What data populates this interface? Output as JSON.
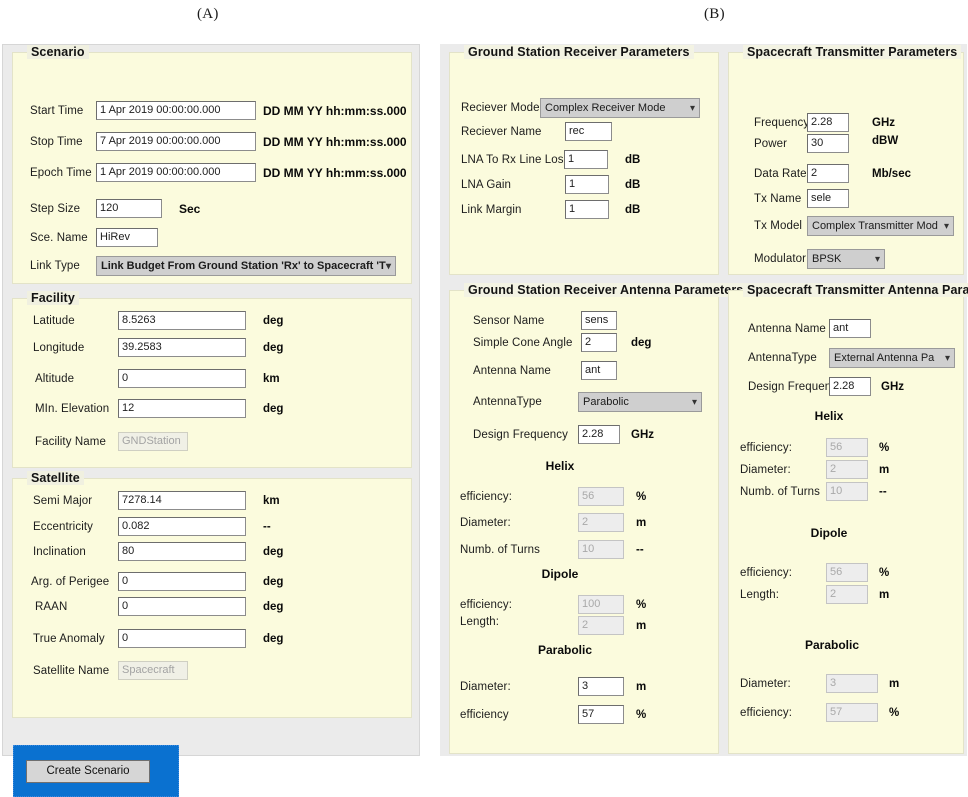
{
  "figure": {
    "label_a": "(A)",
    "label_b": "(B)"
  },
  "panel_a": {
    "scenario": {
      "title": "Scenario",
      "rows": [
        {
          "label": "Start Time",
          "value": "1 Apr 2019 00:00:00.000",
          "unit": "DD MM YY hh:mm:ss.000"
        },
        {
          "label": "Stop Time",
          "value": "7 Apr 2019 00:00:00.000",
          "unit": "DD MM YY hh:mm:ss.000"
        },
        {
          "label": "Epoch Time",
          "value": "1 Apr 2019 00:00:00.000",
          "unit": "DD MM YY hh:mm:ss.000"
        },
        {
          "label": "Step Size",
          "value": "120",
          "unit": "Sec"
        },
        {
          "label": "Sce. Name",
          "value": "HiRev",
          "unit": ""
        }
      ],
      "link_type": {
        "label": "Link Type",
        "value": "Link Budget From Ground Station 'Rx' to Spacecraft 'T",
        "arrow": "chevron-down-icon"
      }
    },
    "facility": {
      "title": "Facility",
      "rows": [
        {
          "label": "Latitude",
          "value": "8.5263",
          "unit": "deg"
        },
        {
          "label": "Longitude",
          "value": "39.2583",
          "unit": "deg"
        },
        {
          "label": "Altitude",
          "value": "0",
          "unit": "km"
        },
        {
          "label": "MIn. Elevation",
          "value": "12",
          "unit": "deg"
        }
      ],
      "facility_name": {
        "label": "Facility Name",
        "value": "GNDStation"
      }
    },
    "satellite": {
      "title": "Satellite",
      "rows": [
        {
          "label": "Semi Major",
          "value": "7278.14",
          "unit": "km"
        },
        {
          "label": "Eccentricity",
          "value": "0.082",
          "unit": "--"
        },
        {
          "label": "Inclination",
          "value": "80",
          "unit": "deg"
        },
        {
          "label": "Arg. of Perigee",
          "value": "0",
          "unit": "deg"
        },
        {
          "label": "RAAN",
          "value": "0",
          "unit": "deg"
        },
        {
          "label": "True Anomaly",
          "value": "0",
          "unit": "deg"
        }
      ],
      "satellite_name": {
        "label": "Satellite Name",
        "value": "Spacecraft"
      }
    },
    "create_button": "Create Scenario"
  },
  "panel_b": {
    "gs_receiver": {
      "title": "Ground Station Receiver Parameters",
      "receiver_model": {
        "label": "Reciever Model",
        "value": "Complex Receiver Mode"
      },
      "rows": [
        {
          "label": "Reciever Name",
          "value": "rec",
          "unit": ""
        },
        {
          "label": "LNA To Rx Line Loss",
          "value": "1",
          "unit": "dB"
        },
        {
          "label": "LNA Gain",
          "value": "1",
          "unit": "dB"
        },
        {
          "label": "Link Margin",
          "value": "1",
          "unit": "dB"
        }
      ]
    },
    "sc_transmitter": {
      "title": "Spacecraft Transmitter Parameters",
      "rows": [
        {
          "label": "Frequency",
          "value": "2.28",
          "unit": "GHz"
        },
        {
          "label": "Power",
          "value": "30",
          "unit": "dBW"
        },
        {
          "label": "Data Rate",
          "value": "2",
          "unit": "Mb/sec"
        },
        {
          "label": "Tx Name",
          "value": "sele",
          "unit": ""
        }
      ],
      "tx_model": {
        "label": "Tx Model",
        "value": "Complex Transmitter Mod"
      },
      "modulator": {
        "label": "Modulator",
        "value": "BPSK"
      }
    },
    "gs_rx_antenna": {
      "title": "Ground Station Receiver Antenna Parameters",
      "rows": [
        {
          "label": "Sensor Name",
          "value": "sens",
          "unit": ""
        },
        {
          "label": "Simple Cone Angle",
          "value": "2",
          "unit": "deg"
        },
        {
          "label": "Antenna Name",
          "value": "ant",
          "unit": ""
        }
      ],
      "antenna_type": {
        "label": "AntennaType",
        "value": "Parabolic"
      },
      "design_frequency": {
        "label": "Design Frequency",
        "value": "2.28",
        "unit": "GHz"
      },
      "helix": {
        "heading": "Helix",
        "rows": [
          {
            "label": "efficiency:",
            "value": "56",
            "unit": "%"
          },
          {
            "label": "Diameter:",
            "value": "2",
            "unit": "m"
          },
          {
            "label": "Numb. of Turns",
            "value": "10",
            "unit": "--"
          }
        ]
      },
      "dipole": {
        "heading": "Dipole",
        "rows": [
          {
            "label": "efficiency:",
            "value": "100",
            "unit": "%"
          },
          {
            "label": "Length:",
            "value": "2",
            "unit": "m"
          }
        ]
      },
      "parabolic": {
        "heading": "Parabolic",
        "rows": [
          {
            "label": "Diameter:",
            "value": "3",
            "unit": "m"
          },
          {
            "label": "efficiency",
            "value": "57",
            "unit": "%"
          }
        ]
      }
    },
    "sc_tx_antenna": {
      "title": "Spacecraft Transmitter Antenna Parameters",
      "antenna_name": {
        "label": "Antenna Name",
        "value": "ant"
      },
      "antenna_type": {
        "label": "AntennaType",
        "value": "External Antenna Pa"
      },
      "design_frequency": {
        "label": "Design Frequency",
        "value": "2.28",
        "unit": "GHz"
      },
      "helix": {
        "heading": "Helix",
        "rows": [
          {
            "label": "efficiency:",
            "value": "56",
            "unit": "%"
          },
          {
            "label": "Diameter:",
            "value": "2",
            "unit": "m"
          },
          {
            "label": "Numb. of Turns",
            "value": "10",
            "unit": "--"
          }
        ]
      },
      "dipole": {
        "heading": "Dipole",
        "rows": [
          {
            "label": "efficiency:",
            "value": "56",
            "unit": "%"
          },
          {
            "label": "Length:",
            "value": "2",
            "unit": "m"
          }
        ]
      },
      "parabolic": {
        "heading": "Parabolic",
        "rows": [
          {
            "label": "Diameter:",
            "value": "3",
            "unit": "m"
          },
          {
            "label": "efficiency:",
            "value": "57",
            "unit": "%"
          }
        ]
      }
    }
  },
  "colors": {
    "panel_fill": "#fbfbdd",
    "window_bg": "#ebebeb",
    "highlight_blue": "#0a71d0"
  }
}
